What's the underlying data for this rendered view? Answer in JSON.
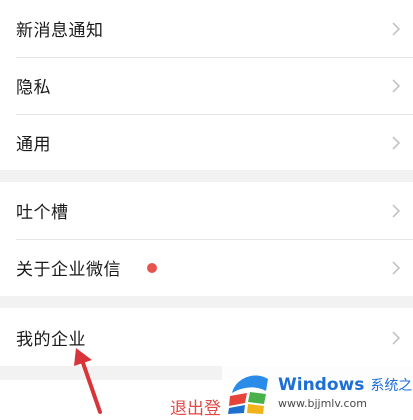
{
  "settings": {
    "group1": [
      {
        "label": "新消息通知"
      },
      {
        "label": "隐私"
      },
      {
        "label": "通用"
      }
    ],
    "group2": [
      {
        "label": "吐个槽"
      },
      {
        "label": "关于企业微信"
      }
    ],
    "group3": [
      {
        "label": "我的企业"
      }
    ],
    "logout_partial": "退出登"
  },
  "watermark": {
    "brand": "Windows",
    "cn": "系统之家",
    "url": "www.bjjmlv.com"
  },
  "colors": {
    "accent_red": "#e8524f",
    "arrow_red": "#d9343a",
    "watermark_blue": "#1d6fd6"
  },
  "icons": {
    "chevron": "chevron-right-icon",
    "badge": "red-dot-badge",
    "annotation": "annotation-arrow-icon",
    "logo": "windows-logo-icon"
  }
}
